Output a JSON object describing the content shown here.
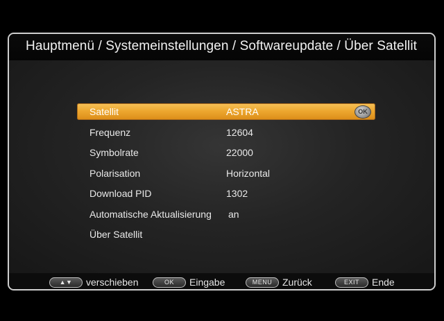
{
  "header": {
    "title": "Hauptmenü / Systemeinstellungen / Softwareupdate / Über Satellit"
  },
  "menu": {
    "items": [
      {
        "label": "Satellit",
        "value": "ASTRA",
        "selected": true
      },
      {
        "label": "Frequenz",
        "value": "12604"
      },
      {
        "label": "Symbolrate",
        "value": "22000"
      },
      {
        "label": "Polarisation",
        "value": "Horizontal"
      },
      {
        "label": "Download PID",
        "value": "1302"
      },
      {
        "label": "Automatische Aktualisierung",
        "value": "an"
      },
      {
        "label": "Über Satellit",
        "value": ""
      }
    ],
    "ok_badge": "OK"
  },
  "footer": {
    "nav_key": "▲▼",
    "nav_label": "verschieben",
    "ok_key": "OK",
    "ok_label": "Eingabe",
    "menu_key": "MENU",
    "menu_label": "Zurück",
    "exit_key": "EXIT",
    "exit_label": "Ende"
  },
  "colors": {
    "highlight": "#eda830",
    "background": "#242424",
    "frame": "#cfcfcf"
  }
}
